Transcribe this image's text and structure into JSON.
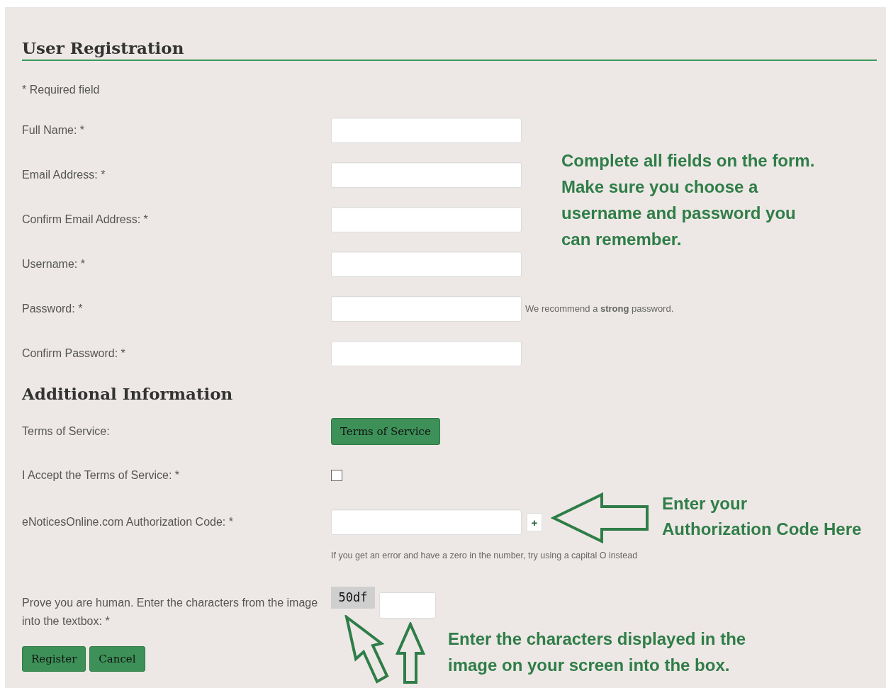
{
  "title": "User Registration",
  "required_note": "* Required field",
  "fields": [
    {
      "label": "Full Name: *"
    },
    {
      "label": "Email Address: *"
    },
    {
      "label": "Confirm Email Address: *"
    },
    {
      "label": "Username: *"
    },
    {
      "label": "Password: *",
      "hint": "We recommend a **strong** password."
    },
    {
      "label": "Confirm Password: *"
    }
  ],
  "additional": {
    "title": "Additional Information",
    "terms": {
      "label": "Terms of Service:",
      "button": "Terms of Service"
    },
    "accept": {
      "label": "I Accept the Terms of Service: *",
      "checked": false
    },
    "auth": {
      "label": "eNoticesOnline.com Authorization Code: *",
      "button": "+",
      "hint": "If you get an error and have a zero in the number, try using a capital O instead"
    },
    "captcha": {
      "label": "Prove you are human. Enter the characters from the image into the textbox: *",
      "code": "50df"
    }
  },
  "buttons": [
    "Register",
    "Cancel"
  ],
  "annotations": {
    "fields": [
      "Complete all fields on the form.",
      "Make sure you choose a",
      "username and password you",
      "can remember."
    ],
    "auth": [
      "Enter your",
      "Authorization Code Here"
    ],
    "captcha": [
      "Enter the characters displayed in the",
      "image on your screen into the box."
    ]
  }
}
